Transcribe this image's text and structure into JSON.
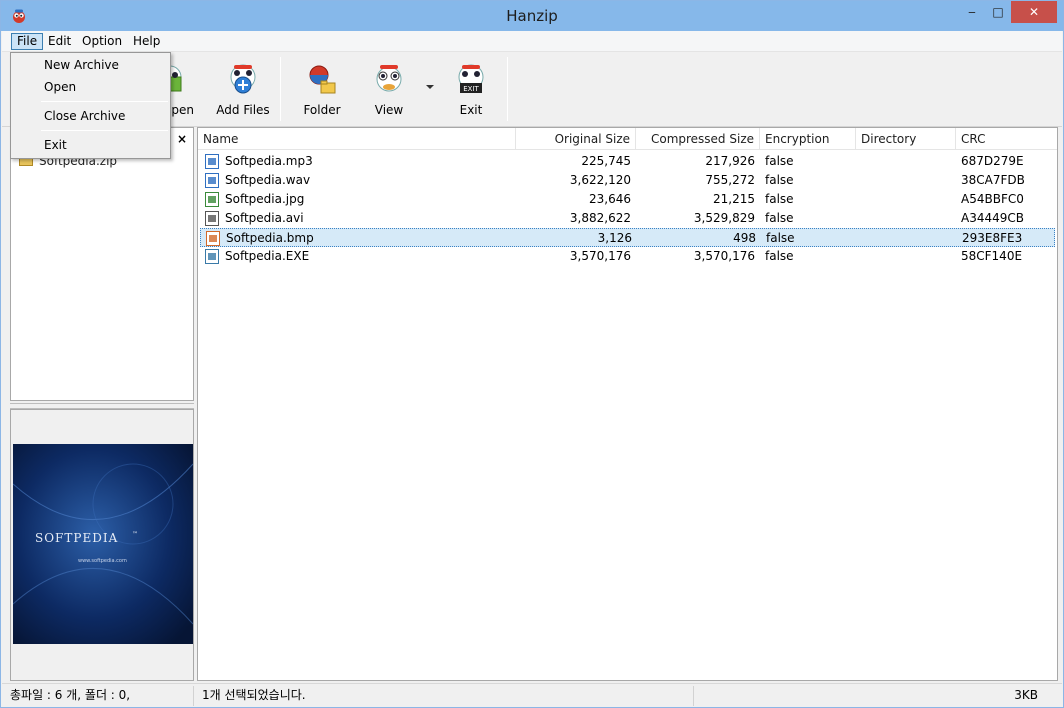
{
  "window": {
    "title": "Hanzip",
    "minimize": "‒",
    "maximize": "□",
    "close": "✕"
  },
  "menu": {
    "items": [
      "File",
      "Edit",
      "Option",
      "Help"
    ],
    "active": "File"
  },
  "file_menu": {
    "items": [
      {
        "label": "New Archive"
      },
      {
        "label": "Open"
      },
      {
        "label": "Close Archive"
      },
      {
        "label": "Exit"
      }
    ]
  },
  "toolbar": {
    "buttons": [
      {
        "label": "Open",
        "icon": "open-icon"
      },
      {
        "label": "Add Files",
        "icon": "add-files-icon"
      },
      {
        "label": "Folder",
        "icon": "folder-icon"
      },
      {
        "label": "View",
        "icon": "view-icon"
      },
      {
        "label": "Exit",
        "icon": "exit-icon"
      }
    ]
  },
  "tree": {
    "close": "×",
    "item": "Softpedia.zip"
  },
  "preview": {
    "brand": "SOFTPEDIA",
    "tm": "™",
    "url": "www.softpedia.com"
  },
  "list": {
    "columns": [
      "Name",
      "Original Size",
      "Compressed Size",
      "Encryption",
      "Directory",
      "CRC"
    ],
    "rows": [
      {
        "name": "Softpedia.mp3",
        "original": "225,745",
        "compressed": "217,926",
        "encryption": "false",
        "directory": "",
        "crc": "687D279E",
        "icon": "audio-file-icon"
      },
      {
        "name": "Softpedia.wav",
        "original": "3,622,120",
        "compressed": "755,272",
        "encryption": "false",
        "directory": "",
        "crc": "38CA7FDB",
        "icon": "audio-file-icon"
      },
      {
        "name": "Softpedia.jpg",
        "original": "23,646",
        "compressed": "21,215",
        "encryption": "false",
        "directory": "",
        "crc": "A54BBFC0",
        "icon": "image-file-icon"
      },
      {
        "name": "Softpedia.avi",
        "original": "3,882,622",
        "compressed": "3,529,829",
        "encryption": "false",
        "directory": "",
        "crc": "A34449CB",
        "icon": "video-file-icon"
      },
      {
        "name": "Softpedia.bmp",
        "original": "3,126",
        "compressed": "498",
        "encryption": "false",
        "directory": "",
        "crc": "293E8FE3",
        "icon": "bitmap-file-icon"
      },
      {
        "name": "Softpedia.EXE",
        "original": "3,570,176",
        "compressed": "3,570,176",
        "encryption": "false",
        "directory": "",
        "crc": "58CF140E",
        "icon": "exe-file-icon"
      }
    ],
    "selected_row": 4
  },
  "status": {
    "left": "총파일 : 6 개, 폴더 : 0,",
    "middle": "1개 선택되었습니다.",
    "right": "3KB"
  },
  "colors": {
    "titlebar": "#86b8ea",
    "selection": "#d6eaf8",
    "close_button": "#c7504a"
  }
}
